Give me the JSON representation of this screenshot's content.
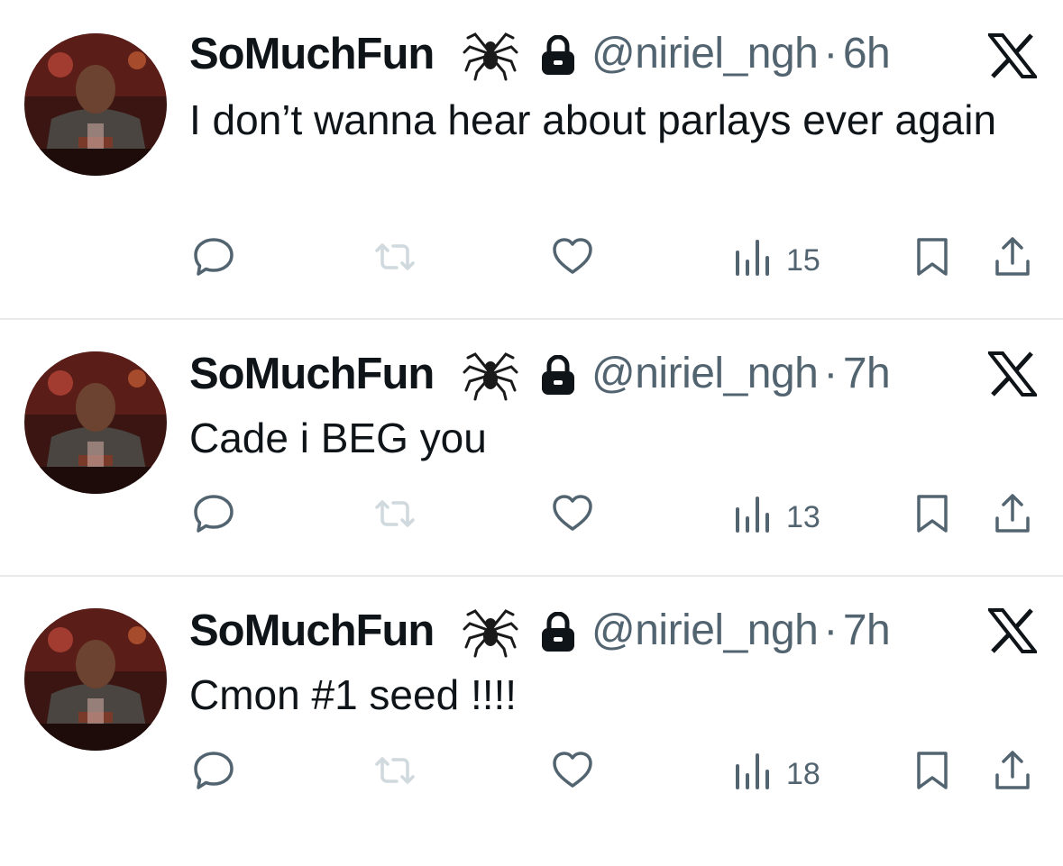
{
  "tweets": [
    {
      "display_name": "SoMuchFun",
      "name_emoji": "spider",
      "handle": "@niriel_ngh",
      "separator": "·",
      "time": "6h",
      "text": "I don’t wanna hear about parlays ever again",
      "views": "15"
    },
    {
      "display_name": "SoMuchFun",
      "name_emoji": "spider",
      "handle": "@niriel_ngh",
      "separator": "·",
      "time": "7h",
      "text": "Cade i BEG you",
      "views": "13"
    },
    {
      "display_name": "SoMuchFun",
      "name_emoji": "spider",
      "handle": "@niriel_ngh",
      "separator": "·",
      "time": "7h",
      "text": "Cmon #1 seed !!!!",
      "views": "18"
    }
  ],
  "icons": {
    "reply": "reply-icon",
    "retweet": "retweet-icon",
    "like": "like-icon",
    "views": "views-icon",
    "bookmark": "bookmark-icon",
    "share": "share-icon",
    "brand": "x-logo-icon",
    "protected": "lock-icon"
  },
  "colors": {
    "text": "#0f1419",
    "secondary": "#536471",
    "retweet_disabled": "#cfd9de",
    "divider": "#e7e9ea"
  }
}
